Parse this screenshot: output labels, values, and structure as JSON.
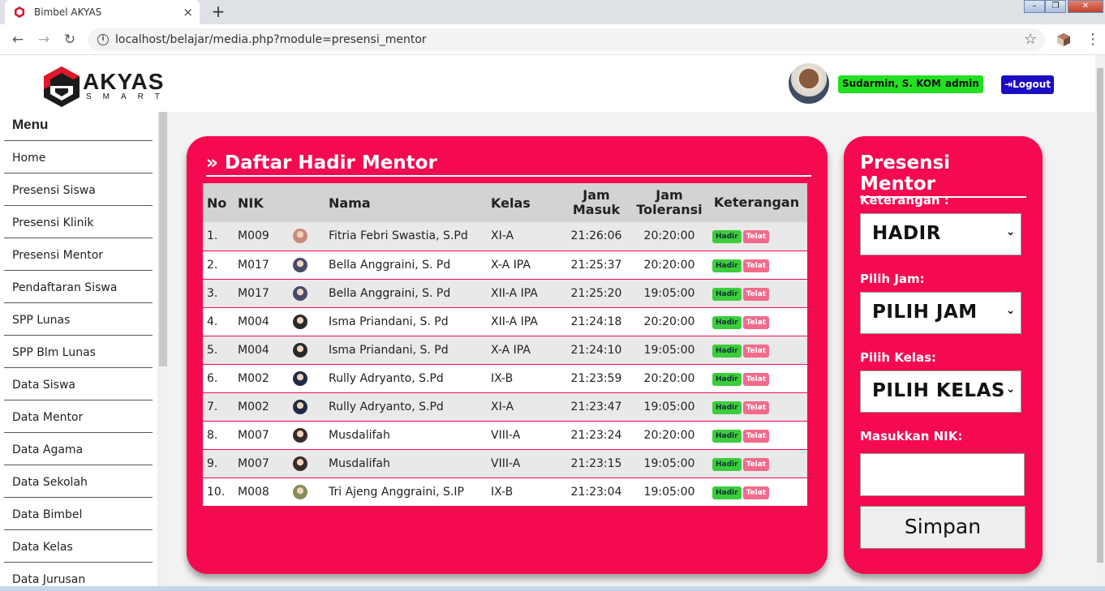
{
  "browser": {
    "tab_title": "Bimbel AKYAS",
    "tab_close": "×",
    "new_tab": "+",
    "url": "localhost/belajar/media.php?module=presensi_mentor"
  },
  "header": {
    "logo_big": "AKYAS",
    "logo_small": "SMART",
    "user_name": "Sudarmin, S. KOM",
    "user_role": "admin",
    "logout_label": "Logout"
  },
  "sidebar": {
    "title": "Menu",
    "items": [
      {
        "label": "Home"
      },
      {
        "label": "Presensi Siswa"
      },
      {
        "label": "Presensi Klinik"
      },
      {
        "label": "Presensi Mentor"
      },
      {
        "label": "Pendaftaran Siswa"
      },
      {
        "label": "SPP Lunas"
      },
      {
        "label": "SPP Blm Lunas"
      },
      {
        "label": "Data Siswa"
      },
      {
        "label": "Data Mentor"
      },
      {
        "label": "Data Agama"
      },
      {
        "label": "Data Sekolah"
      },
      {
        "label": "Data Bimbel"
      },
      {
        "label": "Data Kelas"
      },
      {
        "label": "Data Jurusan"
      }
    ]
  },
  "main": {
    "title": "» Daftar Hadir Mentor",
    "columns": {
      "no": "No",
      "nik": "NIK",
      "nama": "Nama",
      "kelas": "Kelas",
      "jam_masuk_1": "Jam",
      "jam_masuk_2": "Masuk",
      "jam_tol_1": "Jam",
      "jam_tol_2": "Toleransi",
      "keterangan": "Keterangan"
    },
    "hadir_label": "Hadir",
    "telat_label": "Telat",
    "rows": [
      {
        "no": "1.",
        "nik": "M009",
        "nama": "Fitria Febri Swastia, S.Pd",
        "kelas": "XI-A",
        "jam_masuk": "21:26:06",
        "jam_toleransi": "20:20:00",
        "photo_color": "#c98a7a"
      },
      {
        "no": "2.",
        "nik": "M017",
        "nama": "Bella Anggraini, S. Pd",
        "kelas": "X-A IPA",
        "jam_masuk": "21:25:37",
        "jam_toleransi": "20:20:00",
        "photo_color": "#4a4a6a"
      },
      {
        "no": "3.",
        "nik": "M017",
        "nama": "Bella Anggraini, S. Pd",
        "kelas": "XII-A IPA",
        "jam_masuk": "21:25:20",
        "jam_toleransi": "19:05:00",
        "photo_color": "#4a4a6a"
      },
      {
        "no": "4.",
        "nik": "M004",
        "nama": "Isma Priandani, S. Pd",
        "kelas": "XII-A IPA",
        "jam_masuk": "21:24:18",
        "jam_toleransi": "20:20:00",
        "photo_color": "#2a2a2a"
      },
      {
        "no": "5.",
        "nik": "M004",
        "nama": "Isma Priandani, S. Pd",
        "kelas": "X-A IPA",
        "jam_masuk": "21:24:10",
        "jam_toleransi": "19:05:00",
        "photo_color": "#2a2a2a"
      },
      {
        "no": "6.",
        "nik": "M002",
        "nama": "Rully Adryanto, S.Pd",
        "kelas": "IX-B",
        "jam_masuk": "21:23:59",
        "jam_toleransi": "20:20:00",
        "photo_color": "#1f2a44"
      },
      {
        "no": "7.",
        "nik": "M002",
        "nama": "Rully Adryanto, S.Pd",
        "kelas": "XI-A",
        "jam_masuk": "21:23:47",
        "jam_toleransi": "19:05:00",
        "photo_color": "#1f2a44"
      },
      {
        "no": "8.",
        "nik": "M007",
        "nama": "Musdalifah",
        "kelas": "VIII-A",
        "jam_masuk": "21:23:24",
        "jam_toleransi": "20:20:00",
        "photo_color": "#3a2a2a"
      },
      {
        "no": "9.",
        "nik": "M007",
        "nama": "Musdalifah",
        "kelas": "VIII-A",
        "jam_masuk": "21:23:15",
        "jam_toleransi": "19:05:00",
        "photo_color": "#3a2a2a"
      },
      {
        "no": "10.",
        "nik": "M008",
        "nama": "Tri Ajeng Anggraini, S.IP",
        "kelas": "IX-B",
        "jam_masuk": "21:23:04",
        "jam_toleransi": "19:05:00",
        "photo_color": "#8a8a5a"
      }
    ]
  },
  "form": {
    "title": "Presensi Mentor",
    "keterangan_label": "Keterangan :",
    "keterangan_value": "HADIR",
    "jam_label": "Pilih Jam:",
    "jam_value": "PILIH JAM",
    "kelas_label": "Pilih Kelas:",
    "kelas_value": "PILIH KELAS",
    "nik_label": "Masukkan NIK:",
    "nik_value": "",
    "submit_label": "Simpan"
  },
  "colors": {
    "accent": "#f50a4f",
    "badge_green": "#22e022",
    "logout_blue": "#1a0dc4"
  }
}
